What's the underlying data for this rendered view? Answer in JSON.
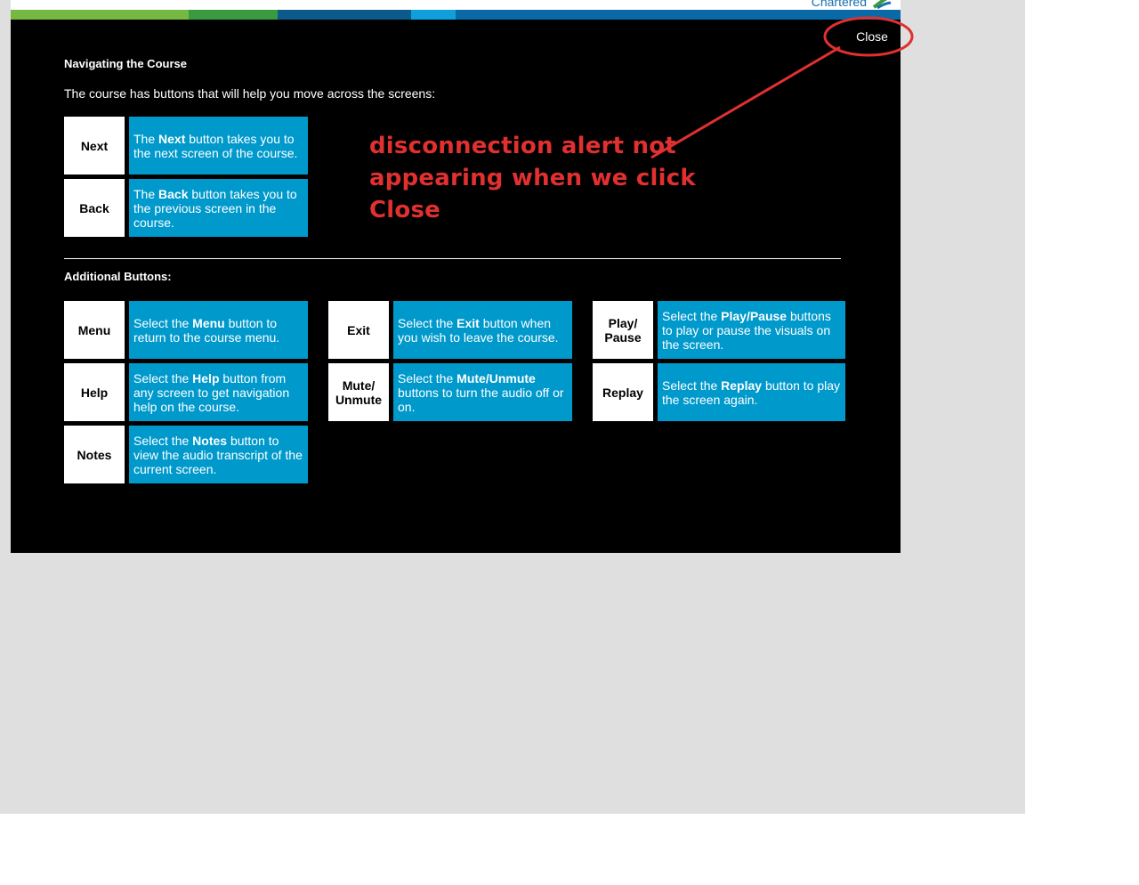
{
  "header": {
    "brand": "Chartered"
  },
  "colors": {
    "stripes": [
      "#75b943",
      "#3a9a40",
      "#0b5a8a",
      "#0b5a8a",
      "#0f9fdb",
      "#0a6aa8"
    ],
    "modal_bg": "#000000",
    "tile_bg": "#0099cc",
    "annotation": "#e03030"
  },
  "modal": {
    "close_label": "Close",
    "title": "Navigating the Course",
    "intro": "The course has buttons that will help you move across the screens:",
    "additional_title": "Additional Buttons:",
    "primary_buttons": [
      {
        "key": "Next",
        "pre": "The ",
        "bold": "Next",
        "post": " button takes you to the next screen of the course."
      },
      {
        "key": "Back",
        "pre": "The ",
        "bold": "Back",
        "post": " button takes you to the previous screen in the course."
      }
    ],
    "additional_buttons": [
      {
        "key": "Menu",
        "pre": "Select the ",
        "bold": "Menu",
        "post": " button to return to the course menu."
      },
      {
        "key": "Exit",
        "pre": "Select the ",
        "bold": "Exit",
        "post": " button when you wish to leave the course."
      },
      {
        "key": "Play/\nPause",
        "pre": "Select the ",
        "bold": "Play/Pause",
        "post": " buttons to play or pause the visuals on the screen."
      },
      {
        "key": "Help",
        "pre": "Select the ",
        "bold": "Help",
        "post": " button from any screen to get navigation help on the course."
      },
      {
        "key": "Mute/\nUnmute",
        "pre": "Select the ",
        "bold": "Mute/Unmute",
        "post": " buttons to turn the audio off or on."
      },
      {
        "key": "Replay",
        "pre": "Select the ",
        "bold": "Replay",
        "post": " button to play the screen again."
      },
      {
        "key": "Notes",
        "pre": "Select the ",
        "bold": "Notes",
        "post": " button to view the audio transcript of the current screen."
      }
    ]
  },
  "annotation": {
    "line1": "disconnection alert not",
    "line2": "appearing when we click Close"
  }
}
